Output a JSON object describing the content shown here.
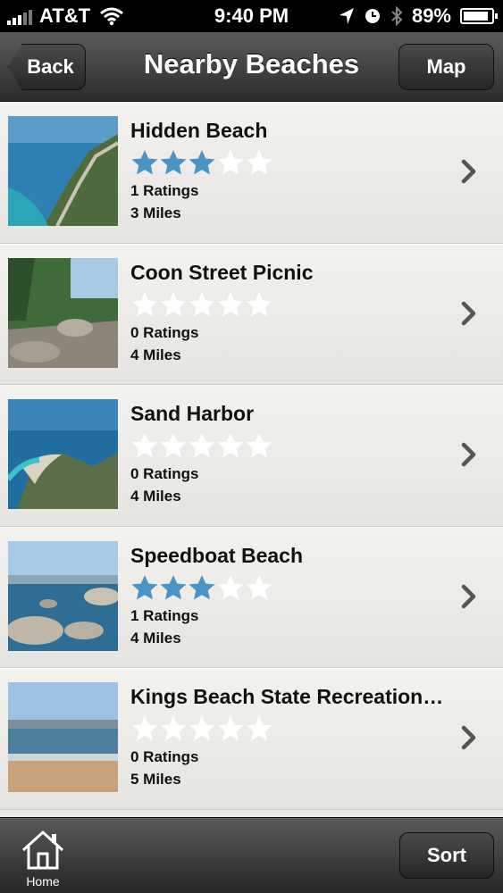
{
  "status_bar": {
    "carrier": "AT&T",
    "time": "9:40 PM",
    "battery": "89%",
    "battery_level": 0.89
  },
  "nav": {
    "title": "Nearby Beaches",
    "back_label": "Back",
    "map_label": "Map"
  },
  "beaches": [
    {
      "name": "Hidden Beach",
      "rating": 3,
      "ratings_text": "1 Ratings",
      "distance": "3 Miles"
    },
    {
      "name": "Coon Street Picnic",
      "rating": 0,
      "ratings_text": "0 Ratings",
      "distance": "4 Miles"
    },
    {
      "name": "Sand Harbor",
      "rating": 0,
      "ratings_text": "0 Ratings",
      "distance": "4 Miles"
    },
    {
      "name": "Speedboat Beach",
      "rating": 3,
      "ratings_text": "1 Ratings",
      "distance": "4 Miles"
    },
    {
      "name": "Kings Beach State Recreation…",
      "rating": 0,
      "ratings_text": "0 Ratings",
      "distance": "5 Miles"
    }
  ],
  "rating_max": 5,
  "colors": {
    "star_on": "#4a93c4",
    "star_off": "#ffffff",
    "nav_bg": "#3b3b3b",
    "list_bg": "#eceae6"
  },
  "toolbar": {
    "home_label": "Home",
    "sort_label": "Sort"
  }
}
